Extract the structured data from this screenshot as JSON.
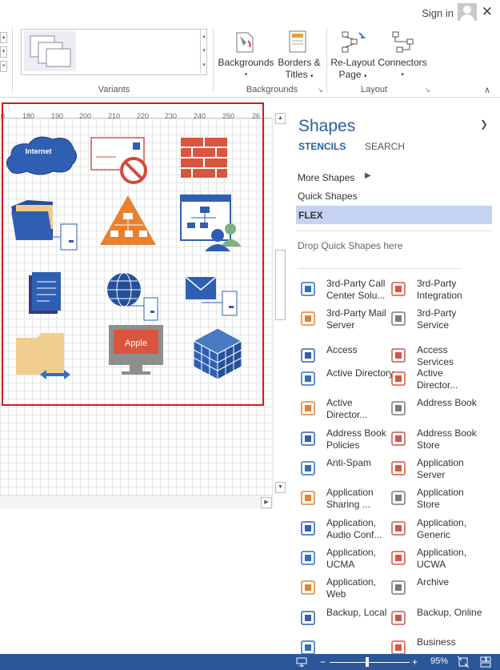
{
  "header": {
    "signin_label": "Sign in",
    "close_glyph": "✕"
  },
  "ribbon": {
    "variants_label": "Variants",
    "backgrounds_group_label": "Backgrounds",
    "layout_group_label": "Layout",
    "backgrounds_btn": [
      "Backgrounds"
    ],
    "borders_btn": [
      "Borders &",
      "Titles"
    ],
    "relayout_btn": [
      "Re-Layout",
      "Page"
    ],
    "connectors_btn": [
      "Connectors"
    ]
  },
  "ruler": {
    "ticks": [
      "0",
      "180",
      "190",
      "200",
      "210",
      "220",
      "230",
      "240",
      "250",
      "26"
    ]
  },
  "canvas": {
    "internet_label": "Internet",
    "apple_label": "Apple"
  },
  "panel": {
    "title": "Shapes",
    "tabs": [
      "STENCILS",
      "SEARCH"
    ],
    "more_shapes": "More Shapes",
    "quick_shapes": "Quick Shapes",
    "flex": "FLEX",
    "drop_hint": "Drop Quick Shapes here",
    "items": [
      {
        "label": "3rd-Party Call Center Solu...",
        "icon": "call-center-icon"
      },
      {
        "label": "3rd-Party Integration",
        "icon": "integration-icon"
      },
      {
        "label": "3rd-Party Mail Server",
        "icon": "mail-server-icon"
      },
      {
        "label": "3rd-Party Service",
        "icon": "service-icon"
      },
      {
        "label": "Access",
        "icon": "access-icon"
      },
      {
        "label": "Access Services",
        "icon": "access-services-icon"
      },
      {
        "label": "Active Directory",
        "icon": "active-directory-icon"
      },
      {
        "label": "Active Director...",
        "icon": "active-directory-2-icon"
      },
      {
        "label": "Active Director...",
        "icon": "active-directory-3-icon"
      },
      {
        "label": "Address Book",
        "icon": "address-book-icon"
      },
      {
        "label": "Address Book Policies",
        "icon": "address-book-policies-icon"
      },
      {
        "label": "Address Book Store",
        "icon": "address-book-store-icon"
      },
      {
        "label": "Anti-Spam",
        "icon": "anti-spam-icon"
      },
      {
        "label": "Application Server",
        "icon": "application-server-icon"
      },
      {
        "label": "Application Sharing ...",
        "icon": "application-sharing-icon"
      },
      {
        "label": "Application Store",
        "icon": "application-store-icon"
      },
      {
        "label": "Application, Audio Conf...",
        "icon": "application-audio-icon"
      },
      {
        "label": "Application, Generic",
        "icon": "application-generic-icon"
      },
      {
        "label": "Application, UCMA",
        "icon": "application-ucma-icon"
      },
      {
        "label": "Application, UCWA",
        "icon": "application-ucwa-icon"
      },
      {
        "label": "Application, Web",
        "icon": "application-web-icon"
      },
      {
        "label": "Archive",
        "icon": "archive-icon"
      },
      {
        "label": "Backup, Local",
        "icon": "backup-local-icon"
      },
      {
        "label": "Backup, Online",
        "icon": "backup-online-icon"
      },
      {
        "label": "",
        "icon": "more-icon"
      },
      {
        "label": "Business",
        "icon": "business-icon"
      }
    ]
  },
  "status": {
    "zoom": "95%",
    "zoom_minus": "−",
    "zoom_plus": "+"
  }
}
